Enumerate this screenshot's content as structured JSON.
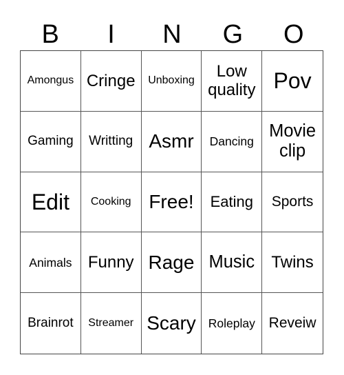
{
  "header": {
    "letters": [
      "B",
      "I",
      "N",
      "G",
      "O"
    ]
  },
  "grid": {
    "rows": [
      [
        "Amongus",
        "Cringe",
        "Unboxing",
        "Low quality",
        "Pov"
      ],
      [
        "Gaming",
        "Writting",
        "Asmr",
        "Dancing",
        "Movie clip"
      ],
      [
        "Edit",
        "Cooking",
        "Free!",
        "Eating",
        "Sports"
      ],
      [
        "Animals",
        "Funny",
        "Rage",
        "Music",
        "Twins"
      ],
      [
        "Brainrot",
        "Streamer",
        "Scary",
        "Roleplay",
        "Reveiw"
      ]
    ]
  }
}
